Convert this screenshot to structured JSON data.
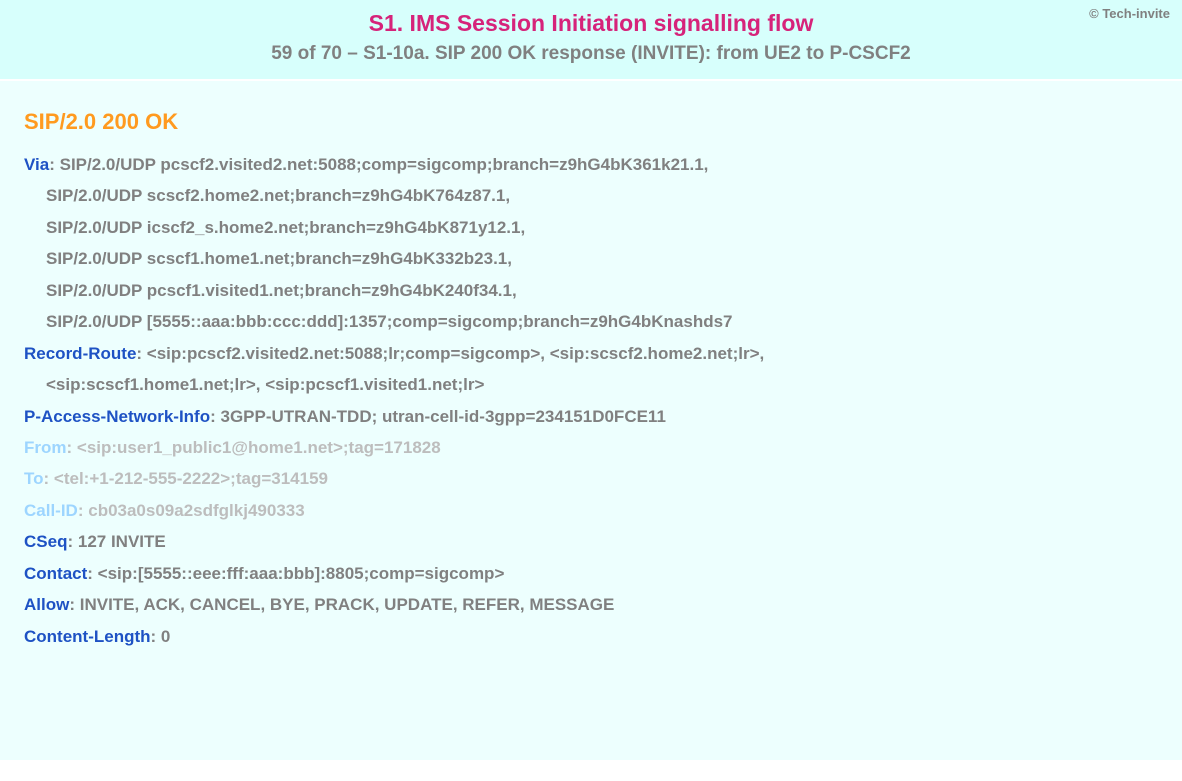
{
  "copyright": "© Tech-invite",
  "header": {
    "title": "S1. IMS Session Initiation signalling flow",
    "subtitle": "59 of 70 – S1-10a. SIP 200 OK response (INVITE): from UE2 to P-CSCF2"
  },
  "sip": {
    "status_line": "SIP/2.0 200 OK",
    "via": {
      "name": "Via",
      "lines": [
        "SIP/2.0/UDP pcscf2.visited2.net:5088;comp=sigcomp;branch=z9hG4bK361k21.1,",
        "SIP/2.0/UDP scscf2.home2.net;branch=z9hG4bK764z87.1,",
        "SIP/2.0/UDP icscf2_s.home2.net;branch=z9hG4bK871y12.1,",
        "SIP/2.0/UDP scscf1.home1.net;branch=z9hG4bK332b23.1,",
        "SIP/2.0/UDP pcscf1.visited1.net;branch=z9hG4bK240f34.1,",
        "SIP/2.0/UDP [5555::aaa:bbb:ccc:ddd]:1357;comp=sigcomp;branch=z9hG4bKnashds7"
      ]
    },
    "record_route": {
      "name": "Record-Route",
      "lines": [
        "<sip:pcscf2.visited2.net:5088;lr;comp=sigcomp>, <sip:scscf2.home2.net;lr>,",
        "<sip:scscf1.home1.net;lr>, <sip:pcscf1.visited1.net;lr>"
      ]
    },
    "pani": {
      "name": "P-Access-Network-Info",
      "value": "3GPP-UTRAN-TDD; utran-cell-id-3gpp=234151D0FCE11"
    },
    "from": {
      "name": "From",
      "value": "<sip:user1_public1@home1.net>;tag=171828"
    },
    "to": {
      "name": "To",
      "value": "<tel:+1-212-555-2222>;tag=314159"
    },
    "callid": {
      "name": "Call-ID",
      "value": "cb03a0s09a2sdfglkj490333"
    },
    "cseq": {
      "name": "CSeq",
      "value": "127 INVITE"
    },
    "contact": {
      "name": "Contact",
      "value": "<sip:[5555::eee:fff:aaa:bbb]:8805;comp=sigcomp>"
    },
    "allow": {
      "name": "Allow",
      "value": "INVITE, ACK, CANCEL, BYE, PRACK, UPDATE, REFER, MESSAGE"
    },
    "content_length": {
      "name": "Content-Length",
      "value": "0"
    }
  }
}
